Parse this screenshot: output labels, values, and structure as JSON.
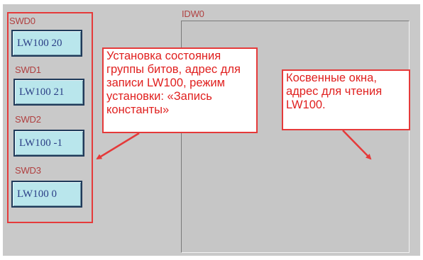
{
  "labels": {
    "swd0": "SWD0",
    "swd1": "SWD1",
    "swd2": "SWD2",
    "swd3": "SWD3",
    "idw0": "IDW0"
  },
  "swd_values": {
    "swd0": "LW100 20",
    "swd1": "LW100 21",
    "swd2": "LW100 -1",
    "swd3": "LW100 0"
  },
  "callouts": {
    "left": "Установка состояния группы битов, адрес для записи LW100, режим установки: «Запись константы»",
    "right": "Косвенные окна, адрес для чтения LW100."
  },
  "colors": {
    "accent_red": "#e53a3a",
    "screen_bg": "#c9c9c9",
    "button_bg": "#b9e6ec",
    "button_text": "#2b3f86"
  }
}
